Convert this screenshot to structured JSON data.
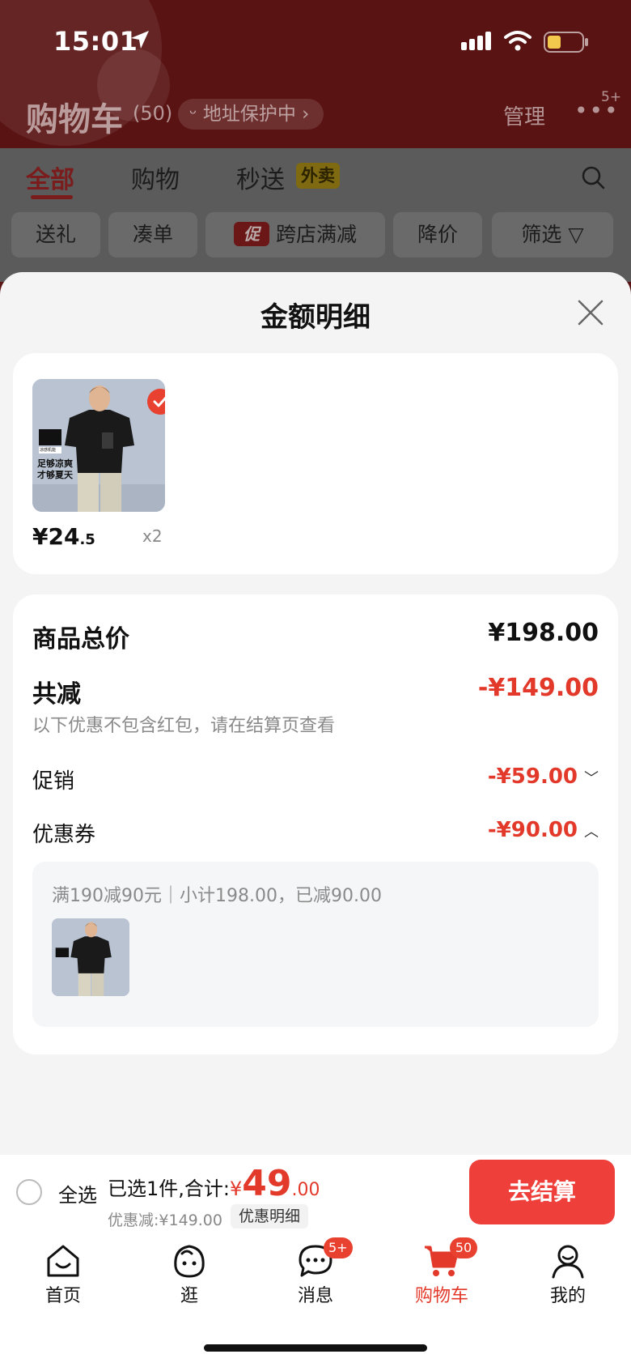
{
  "status_bar": {
    "time": "15:01"
  },
  "header": {
    "title": "购物车",
    "count": "(50)",
    "address_protect": "地址保护中 ›",
    "manage": "管理",
    "more_badge": "5+"
  },
  "tabs": [
    {
      "label": "全部",
      "active": true
    },
    {
      "label": "购物",
      "active": false
    },
    {
      "label": "秒送",
      "active": false,
      "badge": "外卖"
    }
  ],
  "chips": {
    "gift": "送礼",
    "combine": "凑单",
    "promo_badge": "促",
    "cross_store": "跨店满减",
    "price_drop": "降价",
    "filter": "筛选"
  },
  "sheet": {
    "title": "金额明细",
    "item": {
      "price_symbol": "¥",
      "price_int": "24",
      "price_dec": ".5",
      "quantity": "x2",
      "image_caption_line1": "足够凉爽",
      "image_caption_line2": "才够夏天",
      "image_logo_text": "凉感机能"
    },
    "summary": {
      "total_label": "商品总价",
      "total_value": "¥198.00",
      "reduction_label": "共减",
      "reduction_value": "-¥149.00",
      "hint": "以下优惠不包含红包，请在结算页查看",
      "promo_label": "促销",
      "promo_value": "-¥59.00",
      "coupon_label": "优惠券",
      "coupon_value": "-¥90.00",
      "coupon_detail": "满190减90元｜小计198.00，已减90.00"
    }
  },
  "checkout": {
    "select_all": "全选",
    "selected_text": "已选1件,合计:",
    "total_symbol": "¥",
    "total_int": "49",
    "total_dec": ".00",
    "discount_text": "优惠减:¥149.00",
    "detail_button": "优惠明细",
    "checkout_button": "去结算"
  },
  "tabbar": [
    {
      "label": "首页",
      "icon": "home-icon"
    },
    {
      "label": "逛",
      "icon": "face-icon"
    },
    {
      "label": "消息",
      "icon": "message-icon",
      "badge": "5+"
    },
    {
      "label": "购物车",
      "icon": "cart-icon",
      "badge": "50",
      "active": true
    },
    {
      "label": "我的",
      "icon": "profile-icon"
    }
  ],
  "colors": {
    "accent_red": "#e2392a",
    "button_red": "#ee3f3b",
    "overlay_header": "#5a1313"
  }
}
